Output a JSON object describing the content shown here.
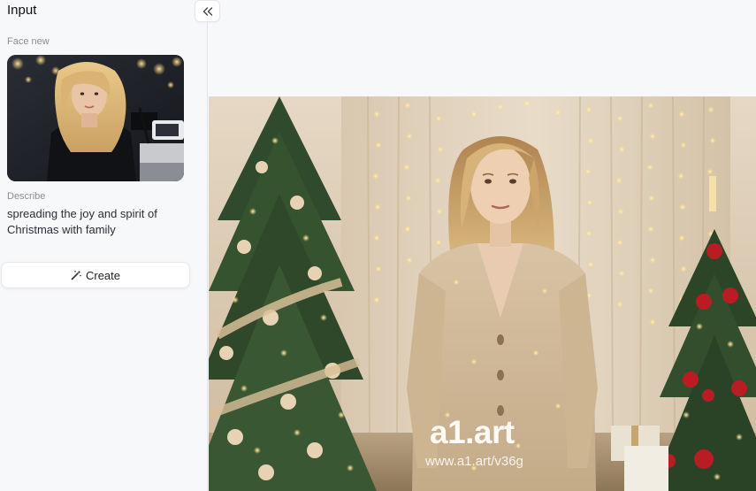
{
  "panel": {
    "title": "Input",
    "face_label": "Face new",
    "describe_label": "Describe",
    "describe_text": "spreading the joy and spirit of Christmas with family",
    "create_label": "Create",
    "create_icon": "magic-wand-icon",
    "collapse_icon": "double-chevron-left-icon"
  },
  "result": {
    "watermark_brand": "a1.art",
    "watermark_url": "www.a1.art/v36g"
  },
  "colors": {
    "panel_bg": "#f7f8fa",
    "border": "#e3e6ea"
  }
}
